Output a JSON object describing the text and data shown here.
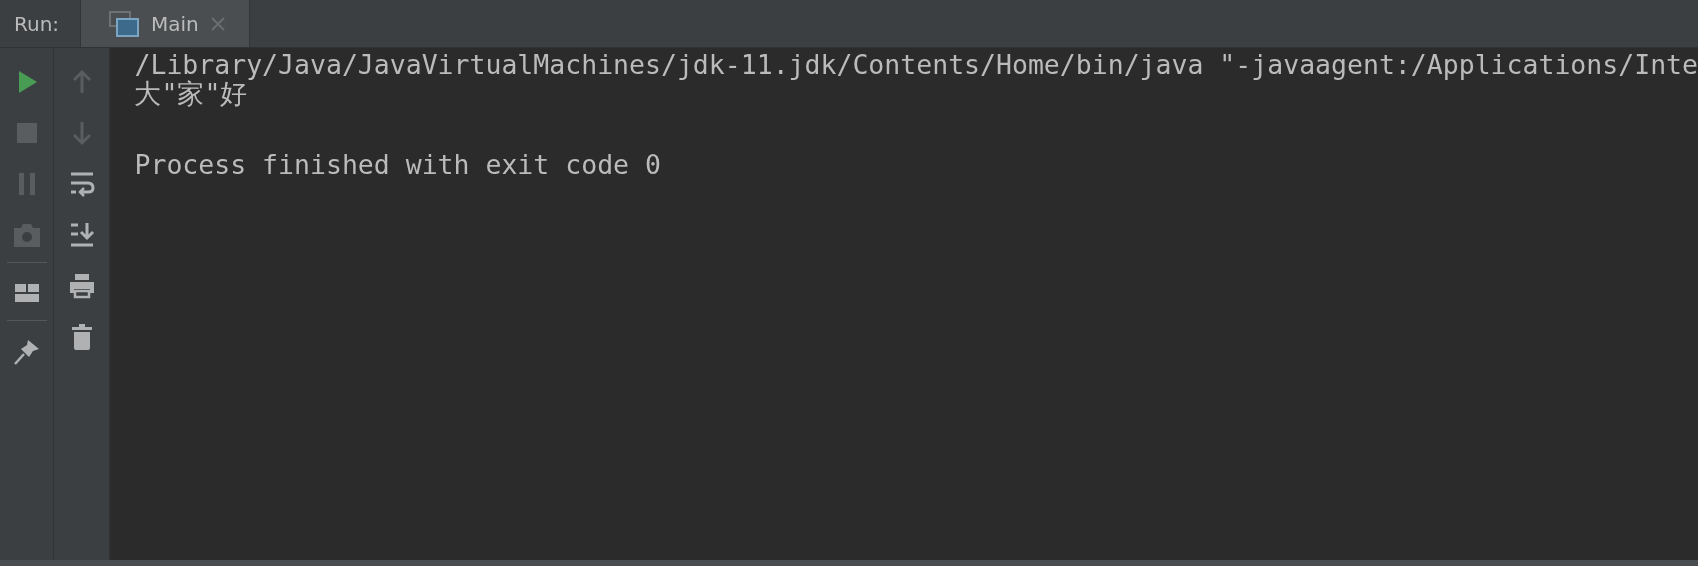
{
  "panel_label": "Run:",
  "tabs": [
    {
      "label": "Main",
      "selected": true
    }
  ],
  "action_groups_left": [
    [
      {
        "kind": "run",
        "disabled": false
      },
      {
        "kind": "stop",
        "disabled": true
      },
      {
        "kind": "pause",
        "disabled": true
      },
      {
        "kind": "camera",
        "disabled": true
      }
    ],
    [
      {
        "kind": "layout",
        "disabled": false
      }
    ],
    [
      {
        "kind": "pin",
        "disabled": false
      }
    ]
  ],
  "actions_right": [
    {
      "kind": "up",
      "disabled": true
    },
    {
      "kind": "down",
      "disabled": true
    },
    {
      "kind": "wrap",
      "disabled": false
    },
    {
      "kind": "scroll_end",
      "disabled": false
    },
    {
      "kind": "print",
      "disabled": false
    },
    {
      "kind": "trash",
      "disabled": false
    }
  ],
  "console": {
    "blocks": [
      [
        "/Library/Java/JavaVirtualMachines/jdk-11.jdk/Contents/Home/bin/java \"-javaagent:/Applications/Inte",
        "大\"家\"好"
      ],
      [
        "Process finished with exit code 0"
      ]
    ]
  }
}
